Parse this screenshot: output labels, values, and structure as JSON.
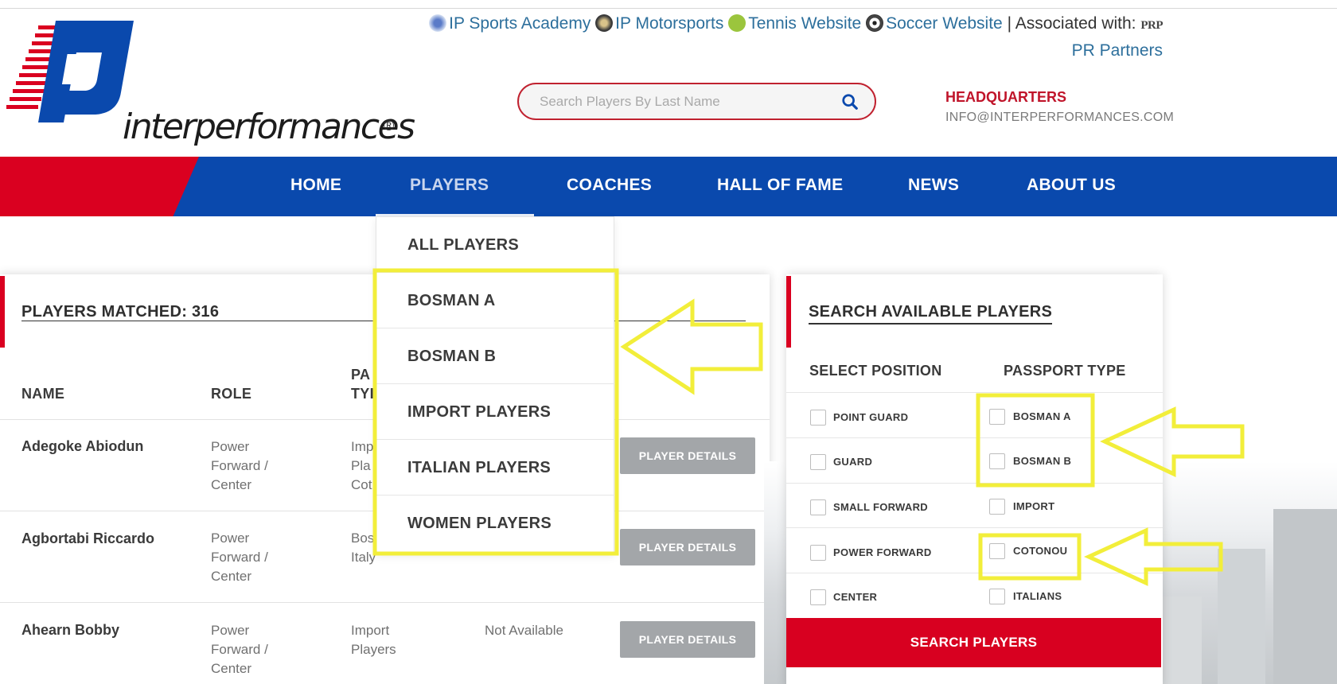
{
  "top_links": {
    "sports_academy": "IP Sports Academy",
    "motorsports": "IP Motorsports",
    "tennis": "Tennis Website",
    "soccer": "Soccer Website",
    "separator": "|",
    "associated_label": "Associated with:",
    "prp_mark": "PRP",
    "pr_partners": "PR Partners"
  },
  "logo": {
    "wordmark": "interperformances",
    "registered": "®"
  },
  "search": {
    "placeholder": "Search Players By Last Name",
    "value": ""
  },
  "headquarters": {
    "title": "HEADQUARTERS",
    "email": "INFO@INTERPERFORMANCES.COM"
  },
  "nav": {
    "items": [
      "HOME",
      "PLAYERS",
      "COACHES",
      "HALL OF FAME",
      "NEWS",
      "ABOUT US"
    ],
    "active": "PLAYERS"
  },
  "dropdown": {
    "items": [
      "ALL PLAYERS",
      "BOSMAN A",
      "BOSMAN B",
      "IMPORT PLAYERS",
      "ITALIAN PLAYERS",
      "WOMEN PLAYERS"
    ]
  },
  "players_panel": {
    "matched_label": "PLAYERS MATCHED: 316",
    "columns": [
      "NAME",
      "ROLE",
      "PA",
      "TYI"
    ],
    "rows": [
      {
        "name": "Adegoke Abiodun",
        "role": [
          "Power",
          "Forward /",
          "Center"
        ],
        "passport": [
          "Imp",
          "Pla",
          "Cot"
        ],
        "availability": "",
        "button": "PLAYER DETAILS"
      },
      {
        "name": "Agbortabi Riccardo",
        "role": [
          "Power",
          "Forward /",
          "Center"
        ],
        "passport": [
          "Bos",
          "Italy"
        ],
        "availability": "",
        "button": "PLAYER DETAILS"
      },
      {
        "name": "Ahearn Bobby",
        "role": [
          "Power",
          "Forward /",
          "Center"
        ],
        "passport": [
          "Import",
          "Players"
        ],
        "availability": "Not Available",
        "button": "PLAYER DETAILS"
      }
    ]
  },
  "search_panel": {
    "title": "SEARCH AVAILABLE PLAYERS",
    "position_header": "SELECT POSITION",
    "passport_header": "PASSPORT TYPE",
    "positions": [
      "POINT GUARD",
      "GUARD",
      "SMALL FORWARD",
      "POWER FORWARD",
      "CENTER"
    ],
    "passports": [
      "BOSMAN A",
      "BOSMAN B",
      "IMPORT",
      "COTONOU",
      "ITALIANS"
    ],
    "button": "SEARCH PLAYERS"
  },
  "colors": {
    "brand_blue": "#0a49ad",
    "brand_red": "#da0020",
    "link_blue": "#2d6f9c",
    "annotation_yellow": "#f2ee3a"
  }
}
